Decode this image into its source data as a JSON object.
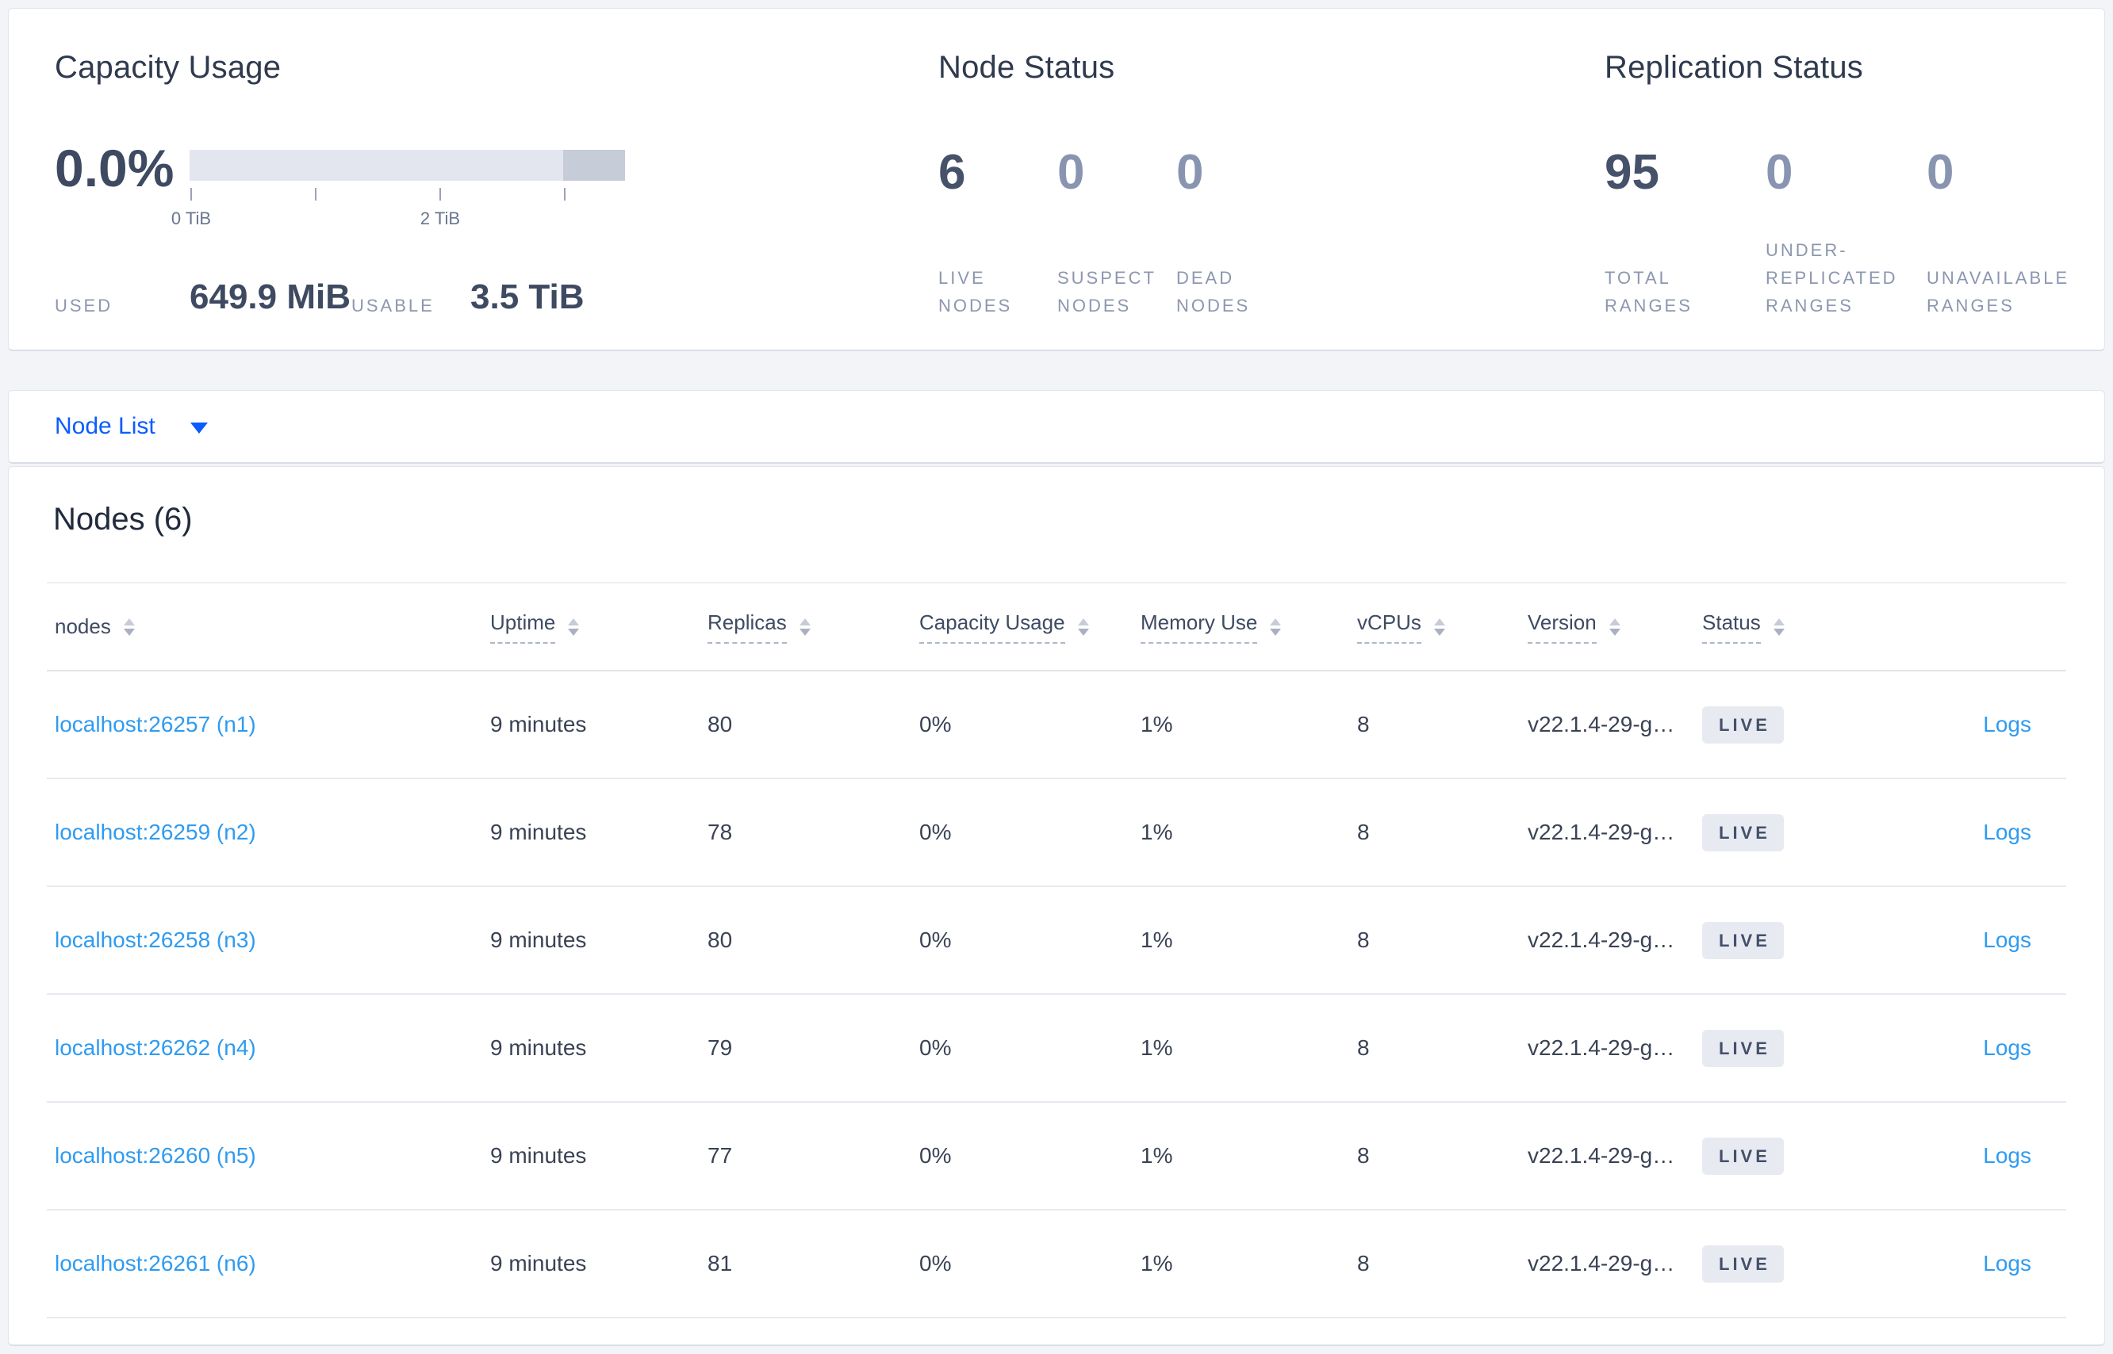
{
  "summary": {
    "capacity": {
      "title": "Capacity Usage",
      "gauge": {
        "percent": "0.0%",
        "tick_labels": [
          "0 TiB",
          "",
          "2 TiB",
          ""
        ],
        "segments": [
          {
            "name": "usable-light",
            "fraction": 0.857,
            "color": "#e3e6ee"
          },
          {
            "name": "reserved-dark",
            "fraction": 0.143,
            "color": "#c7ccd9"
          }
        ]
      },
      "used_label": "USED",
      "used_value": "649.9 MiB",
      "usable_label": "USABLE",
      "usable_value": "3.5 TiB"
    },
    "node_status": {
      "title": "Node Status",
      "stats": [
        {
          "value": "6",
          "emphasis": "high",
          "lines": [
            "LIVE",
            "NODES"
          ]
        },
        {
          "value": "0",
          "emphasis": "low",
          "lines": [
            "SUSPECT",
            "NODES"
          ]
        },
        {
          "value": "0",
          "emphasis": "low",
          "lines": [
            "DEAD",
            "NODES"
          ]
        }
      ]
    },
    "replication_status": {
      "title": "Replication Status",
      "stats": [
        {
          "value": "95",
          "emphasis": "high",
          "lines": [
            "TOTAL",
            "RANGES"
          ]
        },
        {
          "value": "0",
          "emphasis": "low",
          "lines": [
            "UNDER-",
            "REPLICATED",
            "RANGES"
          ]
        },
        {
          "value": "0",
          "emphasis": "low",
          "lines": [
            "UNAVAILABLE",
            "RANGES"
          ]
        }
      ]
    }
  },
  "view_selector": {
    "label": "Node List"
  },
  "nodes_table": {
    "title": "Nodes (6)",
    "columns": [
      {
        "label": "nodes",
        "sortable_underline": false
      },
      {
        "label": "Uptime",
        "sortable_underline": true
      },
      {
        "label": "Replicas",
        "sortable_underline": true
      },
      {
        "label": "Capacity Usage",
        "sortable_underline": true
      },
      {
        "label": "Memory Use",
        "sortable_underline": true
      },
      {
        "label": "vCPUs",
        "sortable_underline": true
      },
      {
        "label": "Version",
        "sortable_underline": true
      },
      {
        "label": "Status",
        "sortable_underline": true
      }
    ],
    "logs_label": "Logs",
    "rows": [
      {
        "address": "localhost:26257 (n1)",
        "uptime": "9 minutes",
        "replicas": "80",
        "capacity_usage": "0%",
        "memory_use": "1%",
        "vcpus": "8",
        "version": "v22.1.4-29-g…",
        "status": "LIVE"
      },
      {
        "address": "localhost:26259 (n2)",
        "uptime": "9 minutes",
        "replicas": "78",
        "capacity_usage": "0%",
        "memory_use": "1%",
        "vcpus": "8",
        "version": "v22.1.4-29-g…",
        "status": "LIVE"
      },
      {
        "address": "localhost:26258 (n3)",
        "uptime": "9 minutes",
        "replicas": "80",
        "capacity_usage": "0%",
        "memory_use": "1%",
        "vcpus": "8",
        "version": "v22.1.4-29-g…",
        "status": "LIVE"
      },
      {
        "address": "localhost:26262 (n4)",
        "uptime": "9 minutes",
        "replicas": "79",
        "capacity_usage": "0%",
        "memory_use": "1%",
        "vcpus": "8",
        "version": "v22.1.4-29-g…",
        "status": "LIVE"
      },
      {
        "address": "localhost:26260 (n5)",
        "uptime": "9 minutes",
        "replicas": "77",
        "capacity_usage": "0%",
        "memory_use": "1%",
        "vcpus": "8",
        "version": "v22.1.4-29-g…",
        "status": "LIVE"
      },
      {
        "address": "localhost:26261 (n6)",
        "uptime": "9 minutes",
        "replicas": "81",
        "capacity_usage": "0%",
        "memory_use": "1%",
        "vcpus": "8",
        "version": "v22.1.4-29-g…",
        "status": "LIVE"
      }
    ]
  },
  "colors": {
    "page_background": "#f2f4f8",
    "accent_blue": "#0b5cff",
    "link_blue": "#2f9bf0",
    "number_primary": "#46526a",
    "number_dim": "#8995b0",
    "badge_background": "#e7eaf1",
    "gauge_light": "#e3e6ee",
    "gauge_dark": "#c7ccd9"
  }
}
